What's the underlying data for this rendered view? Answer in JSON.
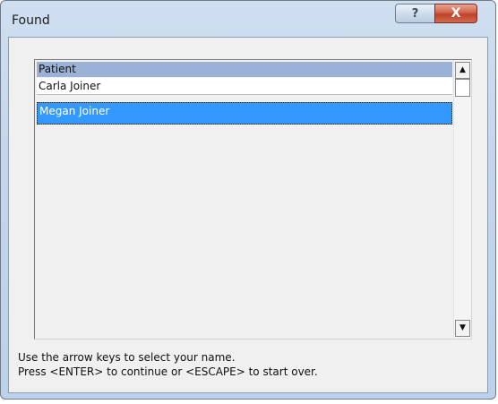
{
  "window": {
    "title": "Found",
    "help_glyph": "?",
    "close_glyph": "X"
  },
  "list": {
    "header": "Patient",
    "rows": [
      {
        "name": "Carla Joiner",
        "selected": false
      },
      {
        "name": "Megan Joiner",
        "selected": true
      }
    ],
    "scroll_up_glyph": "▲",
    "scroll_down_glyph": "▼"
  },
  "instructions": {
    "line1": "Use the arrow keys to select your name.",
    "line2": "Press <ENTER> to continue or <ESCAPE> to start over."
  },
  "colors": {
    "selection": "#3399ff",
    "header": "#9cb1d6",
    "close_button": "#c0412a"
  }
}
